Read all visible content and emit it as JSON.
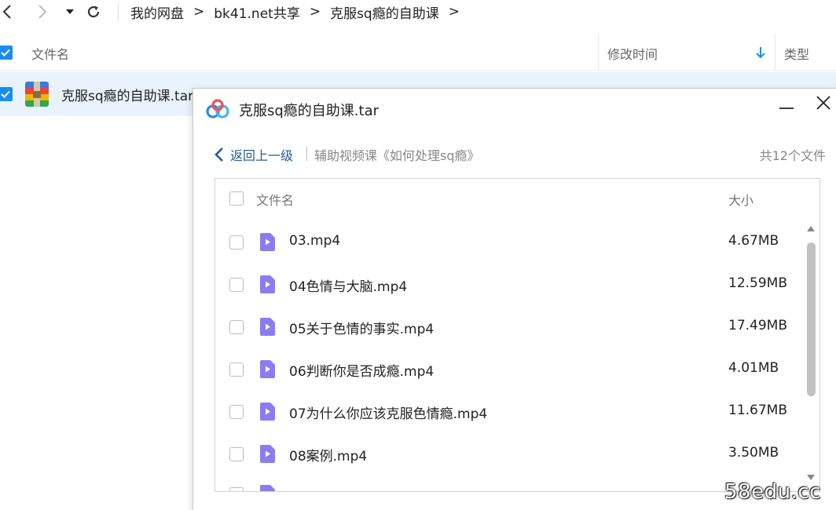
{
  "navbar": {
    "back_icon": "chevron-left-icon",
    "forward_icon": "chevron-right-icon",
    "dropdown_icon": "caret-down-icon",
    "refresh_icon": "refresh-icon",
    "breadcrumb": [
      "我的网盘",
      "bk41.net共享",
      "克服sq瘾的自助课"
    ],
    "separator": ">"
  },
  "file_list": {
    "columns": {
      "name": "文件名",
      "modified": "修改时间",
      "type": "类型"
    },
    "sort_icon": "arrow-down-icon",
    "rows": [
      {
        "name": "克服sq瘾的自助课.tar",
        "selected": true,
        "icon": "archive-icon"
      }
    ]
  },
  "dialog": {
    "title": "克服sq瘾的自助课.tar",
    "back_label": "返回上一级",
    "path": "辅助视频课《如何处理sq瘾》",
    "count": "共12个文件",
    "columns": {
      "name": "文件名",
      "size": "大小"
    },
    "files": [
      {
        "name": "03.mp4",
        "size": "4.67MB"
      },
      {
        "name": "04色情与大脑.mp4",
        "size": "12.59MB"
      },
      {
        "name": "05关于色情的事实.mp4",
        "size": "17.49MB"
      },
      {
        "name": "06判断你是否成瘾.mp4",
        "size": "4.01MB"
      },
      {
        "name": "07为什么你应该克服色情瘾.mp4",
        "size": "11.67MB"
      },
      {
        "name": "08案例.mp4",
        "size": "3.50MB"
      }
    ]
  },
  "watermark": "58edu.cc",
  "colors": {
    "accent": "#1a8cf0",
    "selected_row": "#e8f3fd",
    "video_icon": "#8b7cf2"
  }
}
